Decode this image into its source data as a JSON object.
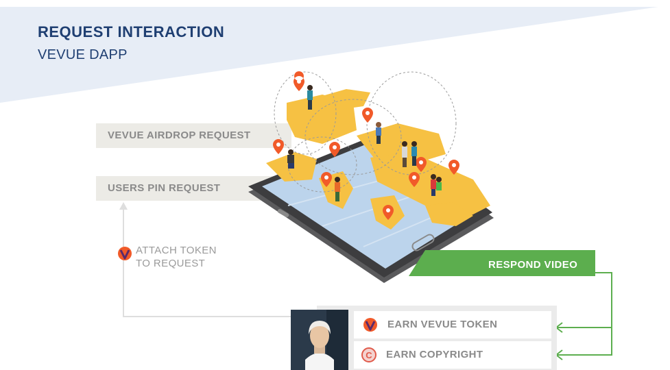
{
  "header": {
    "title": "REQUEST INTERACTION",
    "subtitle": "VEVUE DAPP"
  },
  "requests": {
    "airdrop_label": "VEVUE AIRDROP REQUEST",
    "pin_label": "USERS PIN REQUEST"
  },
  "attach": {
    "line1": "ATTACH TOKEN",
    "line2": "TO REQUEST",
    "icon": "vevue-token-icon"
  },
  "respond": {
    "label": "RESPOND VIDEO"
  },
  "rewards": {
    "token_label": "EARN VEVUE TOKEN",
    "copyright_label": "EARN COPYRIGHT",
    "copyright_glyph": "C"
  },
  "colors": {
    "header_band": "#e7edf6",
    "title": "#1f3f72",
    "label_box": "#ecebe6",
    "label_text": "#8a8a8a",
    "green": "#5cae4e",
    "map_yellow": "#f6c143",
    "phone": "#3d3d3f",
    "screen": "#bcd4ec",
    "token_orange": "#f15a29",
    "token_purple": "#5a2a6b"
  }
}
